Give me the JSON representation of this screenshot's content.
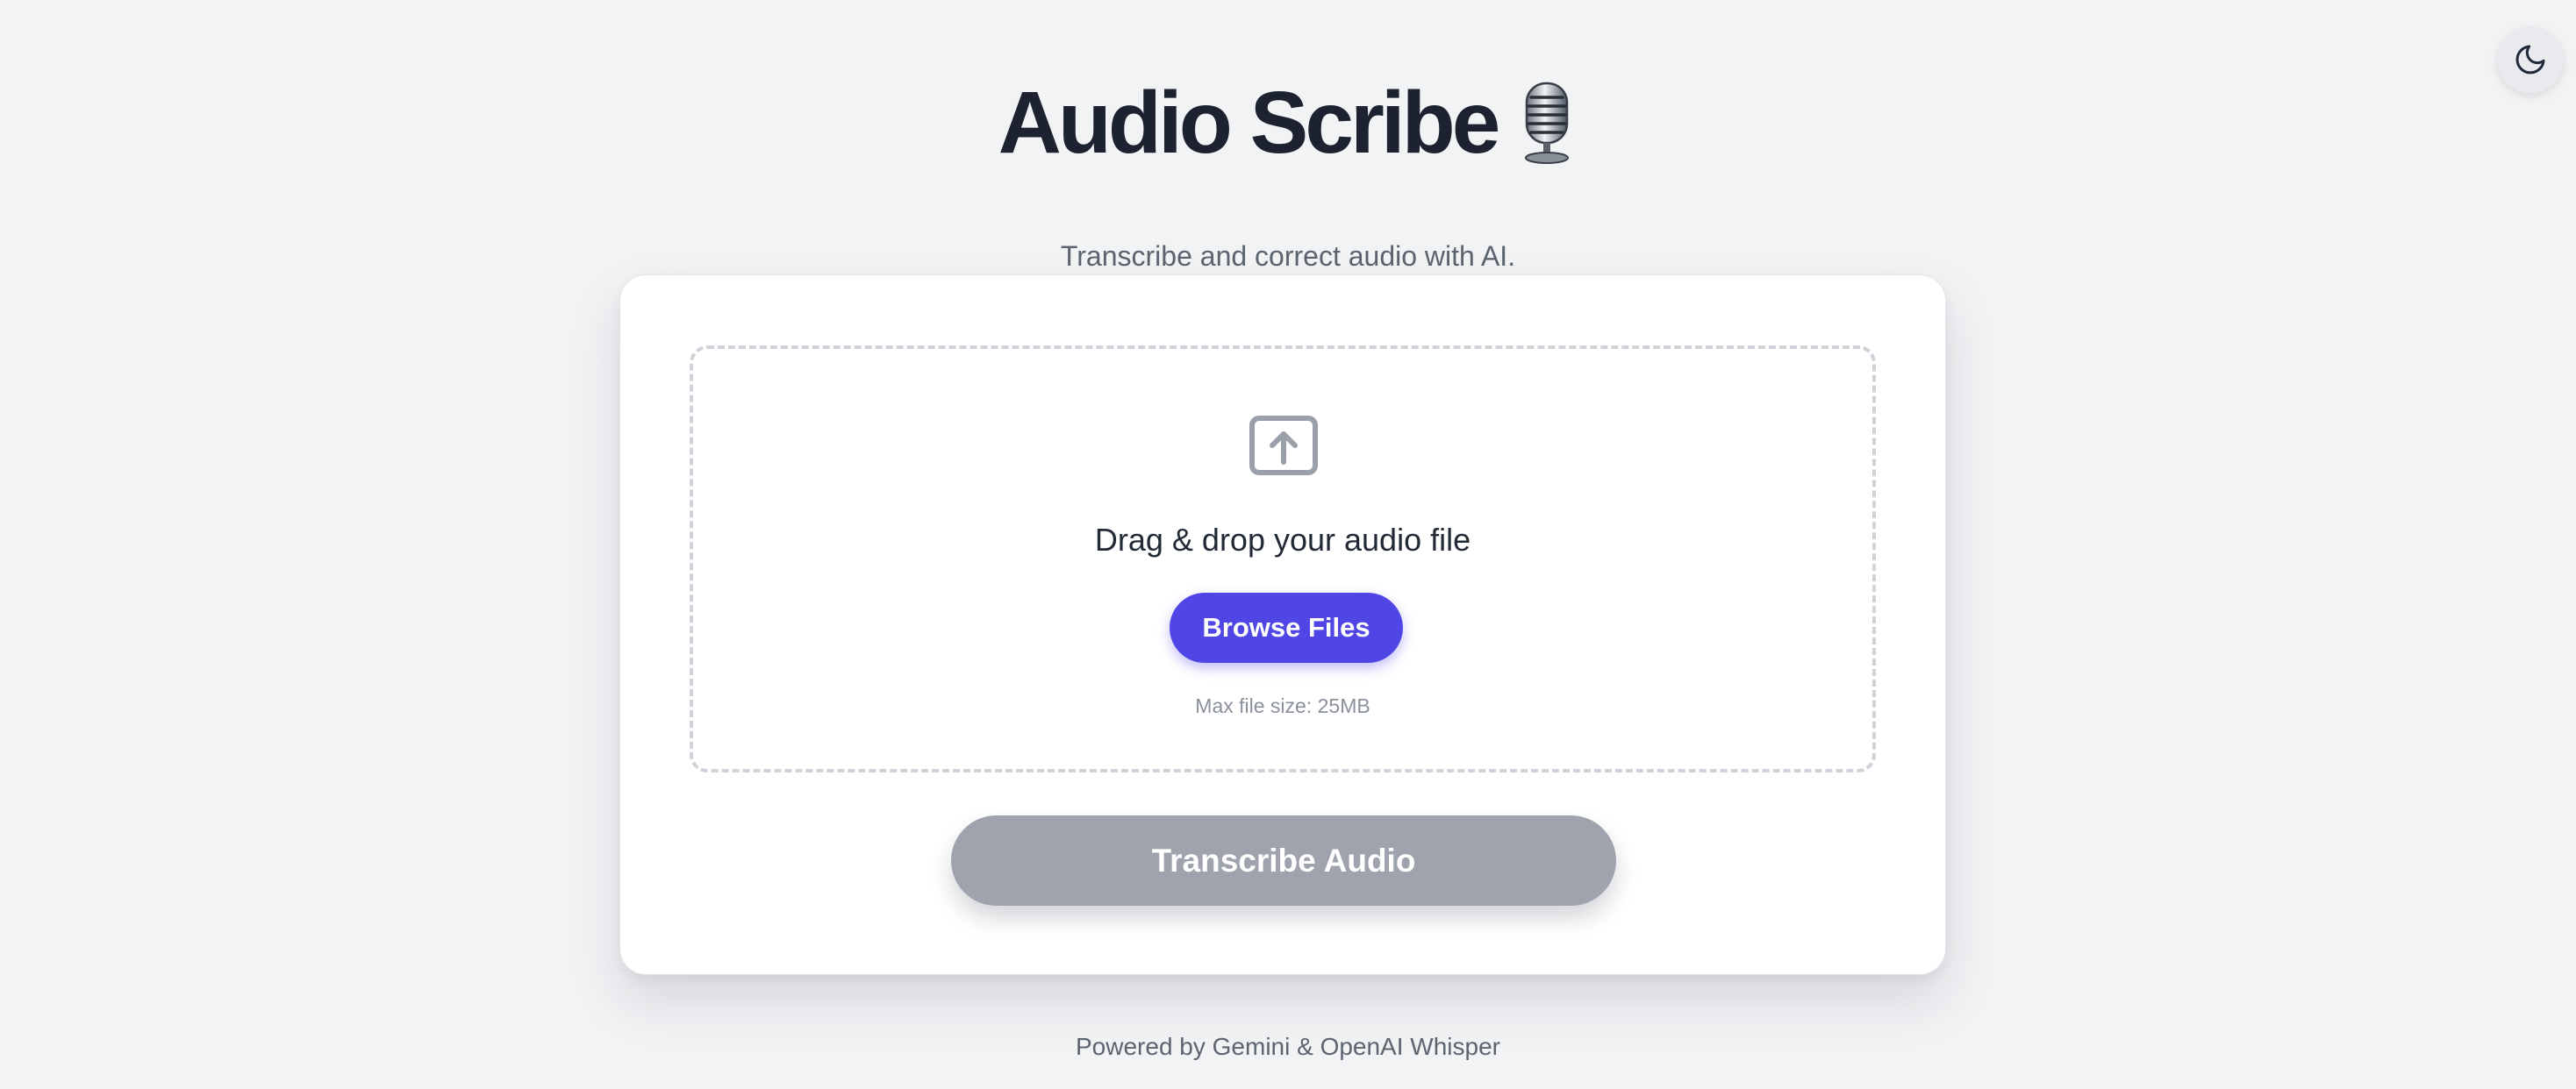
{
  "header": {
    "title": "Audio Scribe",
    "title_icon": "microphone-emoji",
    "subtitle": "Transcribe and correct audio with AI."
  },
  "theme_toggle": {
    "icon": "moon-icon"
  },
  "upload": {
    "icon": "upload-icon",
    "prompt": "Drag & drop your audio file",
    "browse_label": "Browse Files",
    "max_size": "Max file size: 25MB"
  },
  "actions": {
    "transcribe_label": "Transcribe Audio",
    "transcribe_enabled": false
  },
  "footer": {
    "text": "Powered by Gemini & OpenAI Whisper"
  },
  "colors": {
    "background": "#f2f3f5",
    "accent": "#4f46e5",
    "disabled_button": "#9ea3ad",
    "title": "#1c2230"
  }
}
